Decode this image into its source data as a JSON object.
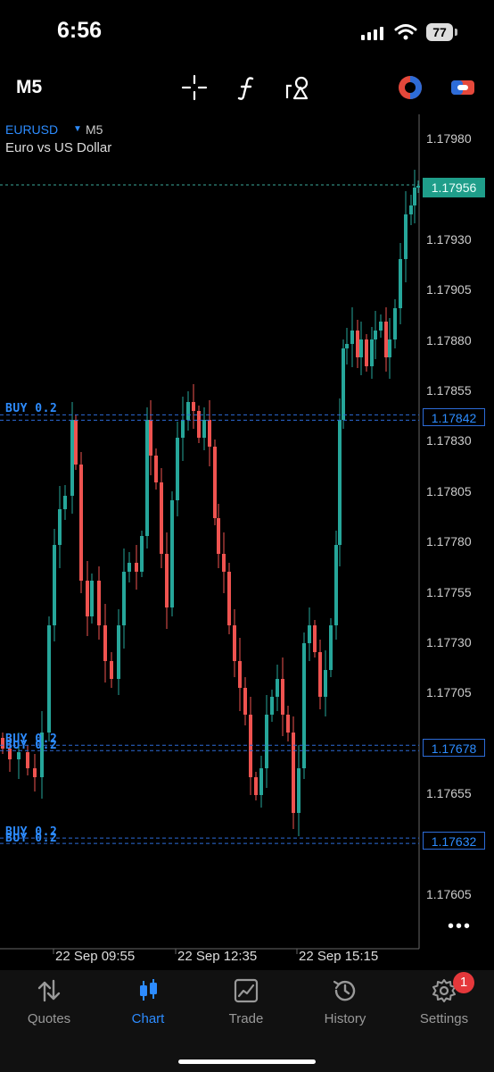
{
  "status_bar": {
    "time": "6:56",
    "battery": "77"
  },
  "toolbar": {
    "timeframe": "M5",
    "icons": [
      "crosshair-icon",
      "function-icon",
      "objects-icon",
      "trading-icon",
      "one-click-icon"
    ]
  },
  "chart": {
    "symbol": "EURUSD",
    "timeframe": "M5",
    "description": "Euro vs US Dollar",
    "current_price": "1.17956",
    "price_axis": [
      "1.17980",
      "1.17930",
      "1.17905",
      "1.17880",
      "1.17855",
      "1.17830",
      "1.17805",
      "1.17780",
      "1.17755",
      "1.17730",
      "1.17705",
      "1.17655",
      "1.17605"
    ],
    "time_axis": [
      "22 Sep 09:55",
      "22 Sep 12:35",
      "22 Sep 15:15"
    ],
    "order_lines": [
      {
        "label": "BUY 0.2",
        "price": "1.17842"
      },
      {
        "label": "BUY 0.2",
        "price": "1.17678"
      },
      {
        "label": "BUY 0.2",
        "price": "1.17632"
      }
    ],
    "colors": {
      "bull": "#26a69a",
      "bear": "#ef5350",
      "order_line": "#2d6cd8",
      "accent": "#2d8cff"
    }
  },
  "tabs": [
    {
      "label": "Quotes",
      "icon": "quotes-icon"
    },
    {
      "label": "Chart",
      "icon": "chart-icon",
      "active": true
    },
    {
      "label": "Trade",
      "icon": "trade-icon"
    },
    {
      "label": "History",
      "icon": "history-icon"
    },
    {
      "label": "Settings",
      "icon": "settings-icon",
      "badge": "1"
    }
  ]
}
